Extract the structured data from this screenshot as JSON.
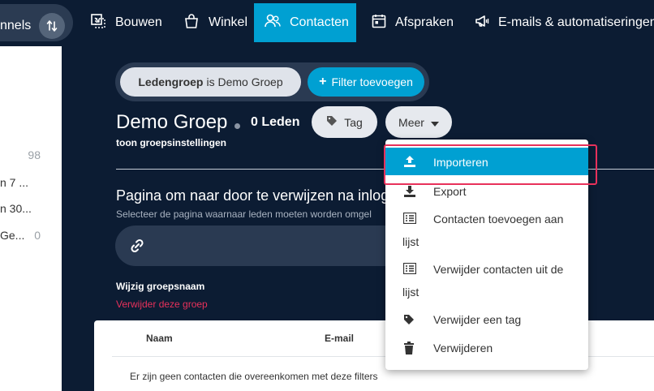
{
  "nav": {
    "funnels_label": "nnels",
    "items": [
      {
        "label": "Bouwen",
        "icon": "build-icon"
      },
      {
        "label": "Winkel",
        "icon": "shopping-bag-icon"
      },
      {
        "label": "Contacten",
        "icon": "contacts-icon",
        "active": true
      },
      {
        "label": "Afspraken",
        "icon": "calendar-icon"
      },
      {
        "label": "E-mails & automatiseringen",
        "icon": "megaphone-icon"
      }
    ]
  },
  "left_panel": {
    "rows": [
      {
        "name": "",
        "count": "98"
      },
      {
        "name": "n 7 ...",
        "count": ""
      },
      {
        "name": "n 30...",
        "count": ""
      },
      {
        "name": "Ge...",
        "count": "0"
      }
    ]
  },
  "filter": {
    "chip_key": "Ledengroep",
    "chip_text": "is Demo Groep",
    "add_label": "Filter toevoegen"
  },
  "group": {
    "title": "Demo Groep",
    "members": "0 Leden",
    "tag_label": "Tag",
    "more_label": "Meer",
    "settings_link": "toon groepsinstellingen"
  },
  "redirect": {
    "title": "Pagina om naar door te verwijzen na inlog",
    "subtitle": "Selecteer de pagina waarnaar leden moeten worden omgel"
  },
  "actions": {
    "rename": "Wijzig groepsnaam",
    "delete_group": "Verwijder deze groep"
  },
  "table": {
    "columns": [
      "Naam",
      "E-mail"
    ],
    "empty_message": "Er zijn geen contacten die overeenkomen met deze filters"
  },
  "dropdown": {
    "items": [
      {
        "label": "Importeren",
        "icon": "upload-icon",
        "active": true
      },
      {
        "label": "Export",
        "icon": "download-icon"
      },
      {
        "label": "Contacten toevoegen aan",
        "label2": "lijst",
        "icon": "list-icon"
      },
      {
        "label": "Verwijder contacten uit de",
        "label2": "lijst",
        "icon": "list-icon"
      },
      {
        "label": "Verwijder een tag",
        "icon": "tag-icon"
      },
      {
        "label": "Verwijderen",
        "icon": "trash-icon"
      }
    ]
  },
  "colors": {
    "nav_bg": "#0c1c33",
    "accent": "#00a0d2",
    "danger": "#e8315b",
    "highlight": "#e8315b"
  }
}
